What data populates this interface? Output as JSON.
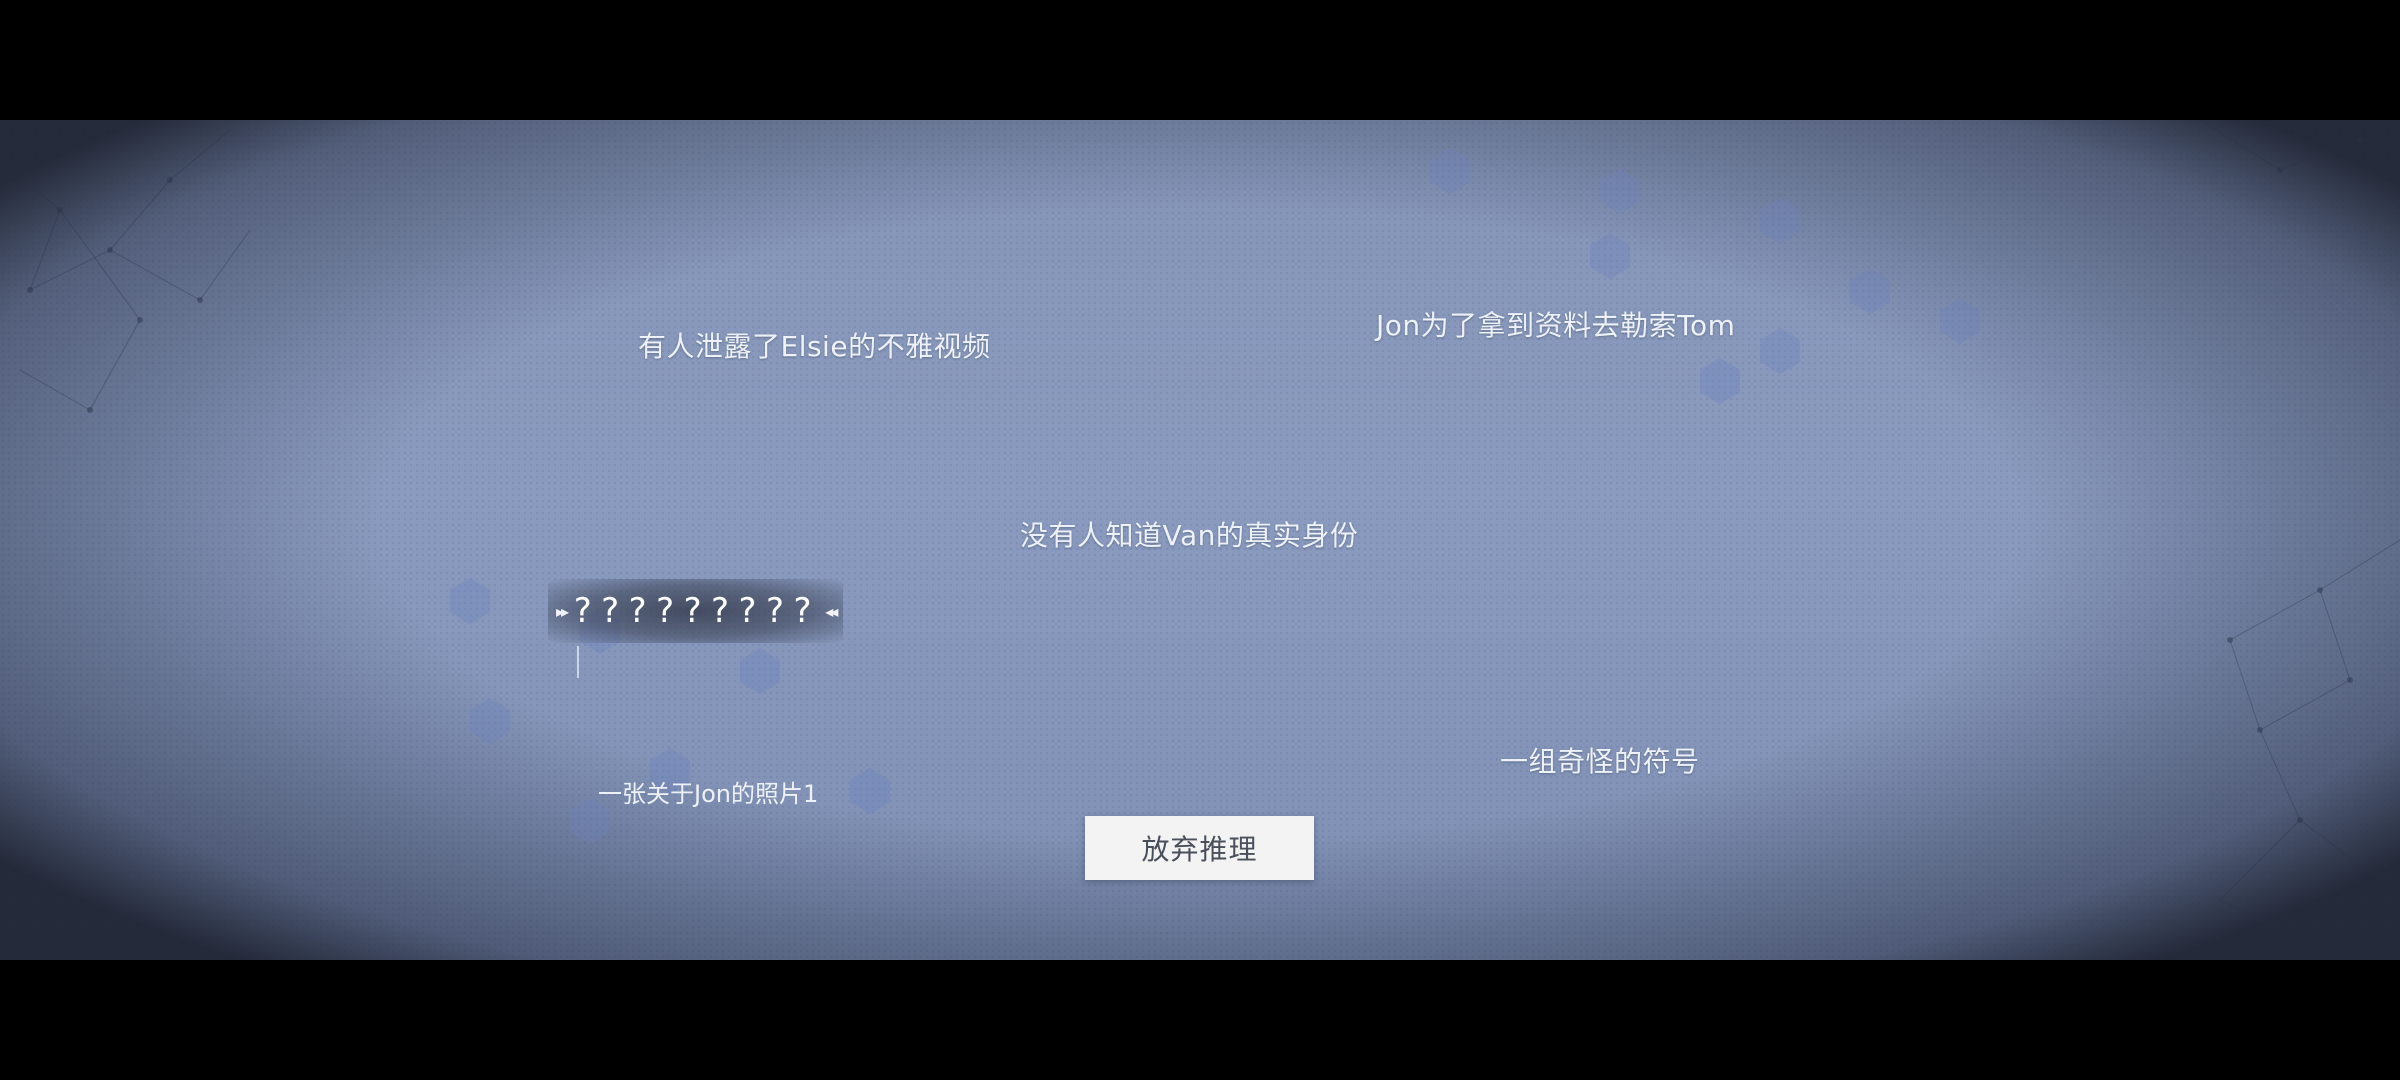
{
  "clues": {
    "elsie_video": "有人泄露了Elsie的不雅视频",
    "jon_blackmail": "Jon为了拿到资料去勒索Tom",
    "van_identity": "没有人知道Van的真实身份",
    "strange_symbols": "一组奇怪的符号"
  },
  "selected_clue": {
    "hidden_text": "?????????",
    "caption": "一张关于Jon的照片1"
  },
  "give_up_button": {
    "label": "放弃推理"
  },
  "colors": {
    "board": "#8a9bbf",
    "text": "#eef1f7",
    "button_bg": "#f3f3f3",
    "button_text": "#4a4f5c"
  }
}
